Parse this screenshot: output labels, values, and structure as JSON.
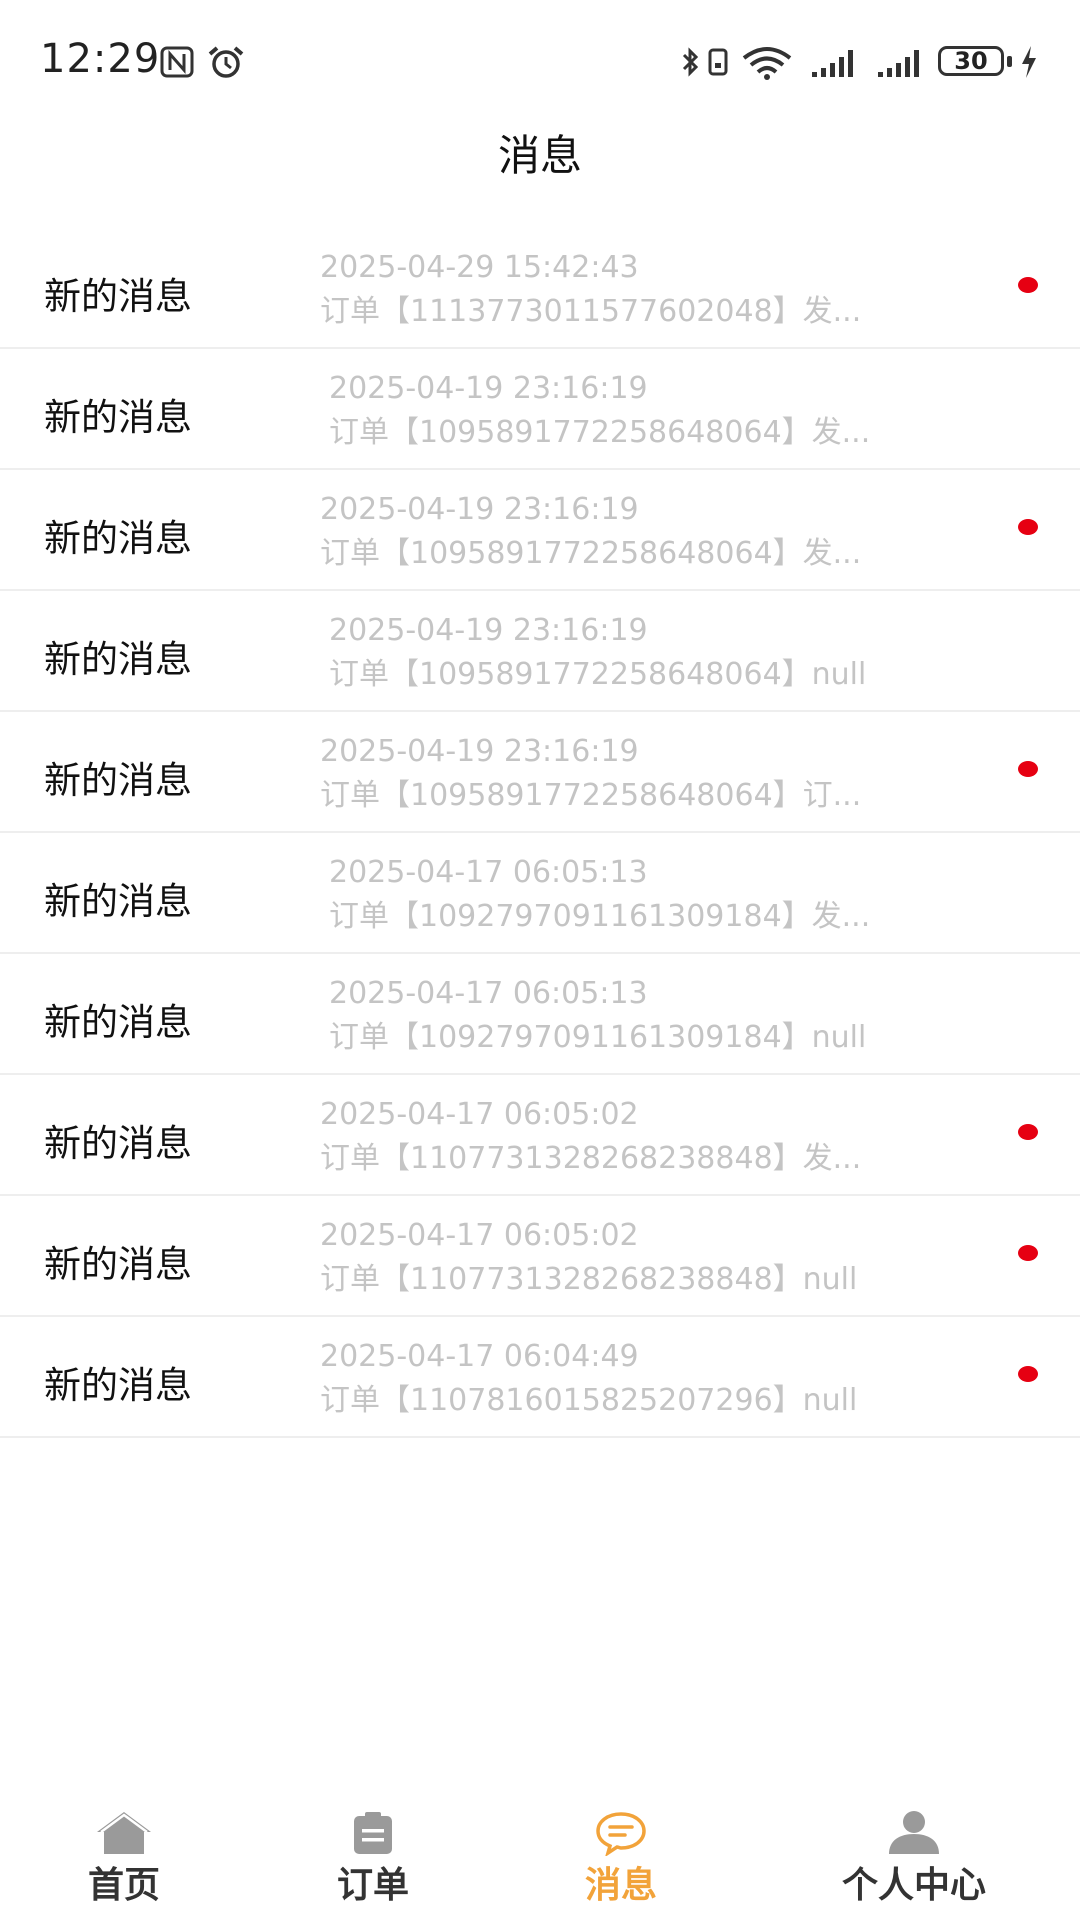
{
  "status_bar": {
    "time": "12:29",
    "battery": "30",
    "icons": [
      "nfc-icon",
      "alarm-icon",
      "bluetooth-icon",
      "vibrate-icon",
      "wifi-icon",
      "signal-icon",
      "signal-icon",
      "battery-icon",
      "charging-icon"
    ]
  },
  "header": {
    "title": "消息"
  },
  "messages": [
    {
      "title": "新的消息",
      "time": "2025-04-29 15:42:43",
      "preview": "订单【1113773011577602048】发...",
      "unread": true
    },
    {
      "title": "新的消息",
      "time": "2025-04-19 23:16:19",
      "preview": "订单【1095891772258648064】发...",
      "unread": false
    },
    {
      "title": "新的消息",
      "time": "2025-04-19 23:16:19",
      "preview": "订单【1095891772258648064】发...",
      "unread": true
    },
    {
      "title": "新的消息",
      "time": "2025-04-19 23:16:19",
      "preview": "订单【1095891772258648064】null",
      "unread": false
    },
    {
      "title": "新的消息",
      "time": "2025-04-19 23:16:19",
      "preview": "订单【1095891772258648064】订...",
      "unread": true
    },
    {
      "title": "新的消息",
      "time": "2025-04-17 06:05:13",
      "preview": "订单【1092797091161309184】发...",
      "unread": false
    },
    {
      "title": "新的消息",
      "time": "2025-04-17 06:05:13",
      "preview": "订单【1092797091161309184】null",
      "unread": false
    },
    {
      "title": "新的消息",
      "time": "2025-04-17 06:05:02",
      "preview": "订单【1107731328268238848】发...",
      "unread": true
    },
    {
      "title": "新的消息",
      "time": "2025-04-17 06:05:02",
      "preview": "订单【1107731328268238848】null",
      "unread": true
    },
    {
      "title": "新的消息",
      "time": "2025-04-17 06:04:49",
      "preview": "订单【1107816015825207296】null",
      "unread": true
    }
  ],
  "tabbar": {
    "tabs": [
      {
        "label": "首页",
        "icon": "home-icon",
        "active": false
      },
      {
        "label": "订单",
        "icon": "clipboard-icon",
        "active": false
      },
      {
        "label": "消息",
        "icon": "chat-bubble-icon",
        "active": true
      },
      {
        "label": "个人中心",
        "icon": "user-icon",
        "active": false
      }
    ]
  },
  "colors": {
    "accent": "#f2a33a",
    "unread_dot": "#e60012",
    "secondary_text": "#c4c4c4",
    "tab_icon_inactive": "#9a9a9a"
  }
}
